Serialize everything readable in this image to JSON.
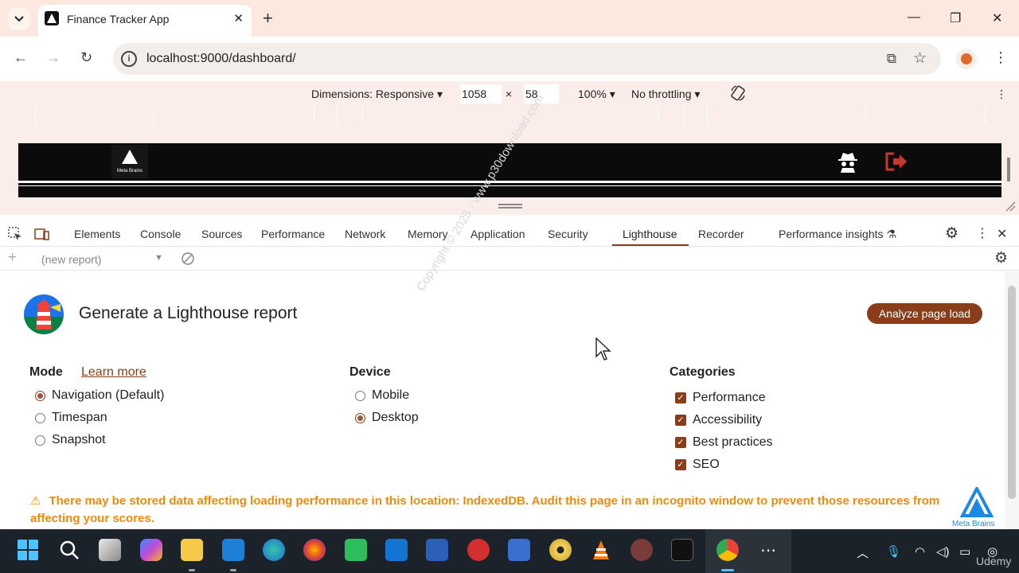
{
  "browser": {
    "tab_title": "Finance Tracker App",
    "url": "localhost:9000/dashboard/"
  },
  "device_toolbar": {
    "dimensions_label": "Dimensions: Responsive",
    "width": "1058",
    "times": "×",
    "height": "58",
    "zoom": "100%",
    "throttling": "No throttling"
  },
  "emulated_page": {
    "logo_text": "Meta Brains"
  },
  "devtools": {
    "tabs": [
      "Elements",
      "Console",
      "Sources",
      "Performance",
      "Network",
      "Memory",
      "Application",
      "Security",
      "Lighthouse",
      "Recorder",
      "Performance insights"
    ],
    "active_tab": "Lighthouse",
    "report_select": "(new report)"
  },
  "lighthouse": {
    "title": "Generate a Lighthouse report",
    "analyze_button": "Analyze page load",
    "mode": {
      "heading": "Mode",
      "learn_more": "Learn more",
      "options": [
        "Navigation (Default)",
        "Timespan",
        "Snapshot"
      ],
      "selected": "Navigation (Default)"
    },
    "device": {
      "heading": "Device",
      "options": [
        "Mobile",
        "Desktop"
      ],
      "selected": "Desktop"
    },
    "categories": {
      "heading": "Categories",
      "options": [
        "Performance",
        "Accessibility",
        "Best practices",
        "SEO"
      ],
      "checked": [
        true,
        true,
        true,
        true
      ]
    },
    "warning": "There may be stored data affecting loading performance in this location: IndexedDB. Audit this page in an incognito window to prevent those resources from affecting your scores."
  },
  "overlay": {
    "watermark": "Copyright © 2025 - www.p30download.com",
    "brand": "Meta Brains",
    "udemy": "Udemy"
  },
  "colors": {
    "accent": "#8a3d1a",
    "warning": "#f08a0a",
    "tabstrip": "#fde8e0",
    "taskbar": "#1c2229"
  }
}
